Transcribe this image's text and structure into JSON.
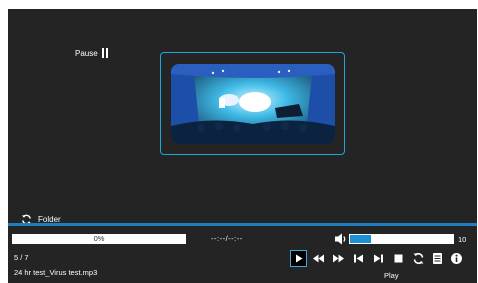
{
  "player": {
    "pause_label": "Pause",
    "folder_label": "Folder",
    "progress_text": "0%",
    "progress_fraction": 0,
    "time_text": "--:--/--:--",
    "volume_value": "10",
    "volume_fraction": 0.2,
    "track_counter": "5 / 7",
    "file_name": "24 hr test_Virus test.mp3",
    "status_label": "Play"
  },
  "controls": [
    {
      "icon": "play-icon",
      "selected": true
    },
    {
      "icon": "rewind-icon"
    },
    {
      "icon": "fast-forward-icon"
    },
    {
      "icon": "skip-previous-icon"
    },
    {
      "icon": "skip-next-icon"
    },
    {
      "icon": "stop-icon"
    },
    {
      "icon": "repeat-icon"
    },
    {
      "icon": "playlist-icon"
    },
    {
      "icon": "info-icon"
    }
  ],
  "colors": {
    "background": "#242424",
    "accent": "#1c7fc4",
    "frame_border": "#1aa7dc"
  }
}
